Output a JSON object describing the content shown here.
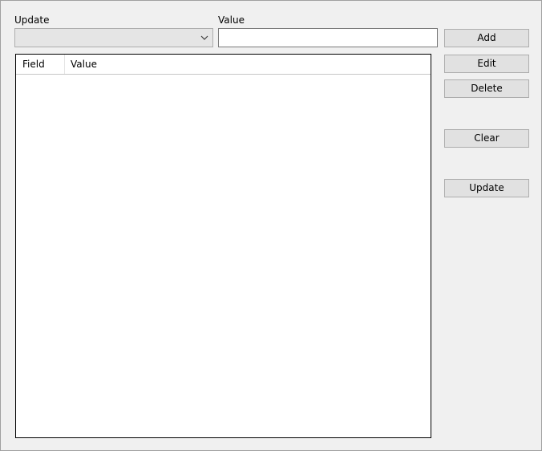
{
  "form": {
    "update_label": "Update",
    "value_label": "Value",
    "update_selected": "",
    "value_text": ""
  },
  "listview": {
    "columns": [
      "Field",
      "Value"
    ],
    "rows": []
  },
  "buttons": {
    "add": "Add",
    "edit": "Edit",
    "delete": "Delete",
    "clear": "Clear",
    "update": "Update"
  },
  "icons": {
    "combo_dropdown": "chevron-down-icon"
  }
}
